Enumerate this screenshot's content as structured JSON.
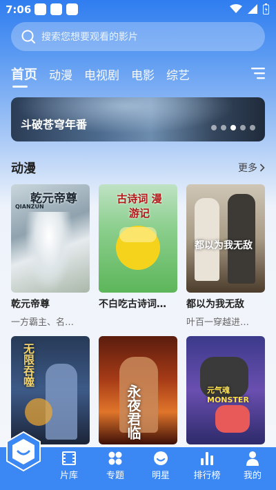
{
  "status": {
    "time": "7:06"
  },
  "search": {
    "placeholder": "搜索您想要观看的影片"
  },
  "tabs": [
    {
      "label": "首页",
      "active": true
    },
    {
      "label": "动漫"
    },
    {
      "label": "电视剧"
    },
    {
      "label": "电影"
    },
    {
      "label": "综艺"
    }
  ],
  "banner": {
    "title": "斗破苍穹年番",
    "dots": 5,
    "active_dot": 3
  },
  "section": {
    "title": "动漫",
    "more": "更多"
  },
  "cards": [
    {
      "title": "乾元帝尊",
      "subtitle": "一方霸主、名…",
      "poster_text": "乾元帝尊",
      "poster_badge": "QIANZUN"
    },
    {
      "title": "不白吃古诗词…",
      "subtitle": "",
      "poster_text": "古诗词 漫游记"
    },
    {
      "title": "都以为我无敌",
      "subtitle": "叶百一穿越进…",
      "poster_text": "都以为我无敌"
    },
    {
      "title": "",
      "subtitle": "",
      "poster_text": "无限吞噬"
    },
    {
      "title": "",
      "subtitle": "",
      "poster_text": "永夜君临"
    },
    {
      "title": "",
      "subtitle": "",
      "poster_text": "元气魂 MONSTER"
    }
  ],
  "nav": [
    {
      "label": "片库",
      "icon": "film-icon"
    },
    {
      "label": "专题",
      "icon": "grid-icon"
    },
    {
      "label": "明星",
      "icon": "star-face-icon"
    },
    {
      "label": "排行榜",
      "icon": "bar-chart-icon"
    },
    {
      "label": "我的",
      "icon": "person-icon"
    }
  ],
  "colors": {
    "primary": "#3b87f3",
    "header": "#2f7df0"
  }
}
